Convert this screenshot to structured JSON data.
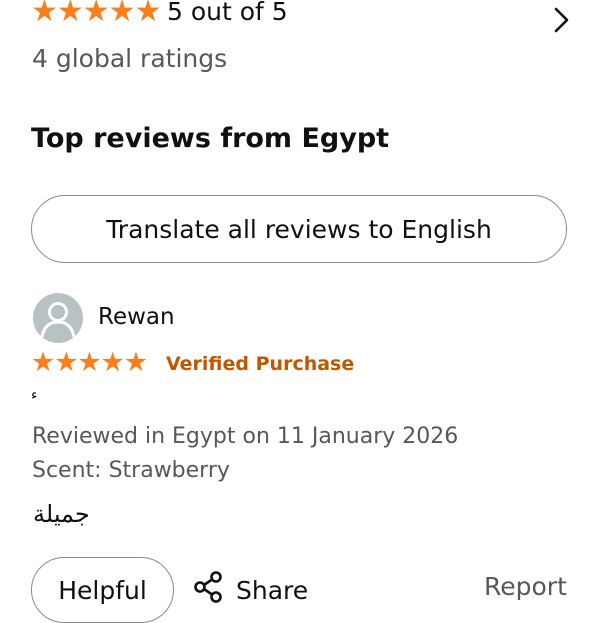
{
  "summary": {
    "stars": "★★★★★",
    "rating_text": "5 out of 5",
    "global_ratings": "4 global ratings"
  },
  "section": {
    "heading": "Top reviews from Egypt",
    "translate_label": "Translate all reviews to English"
  },
  "review": {
    "reviewer": "Rewan",
    "stars": "★★★★★",
    "verified": "Verified Purchase",
    "mark": "ء",
    "reviewed_in": "Reviewed in Egypt on 11 January 2026",
    "scent": "Scent: Strawberry",
    "body": "جميلة",
    "helpful_label": "Helpful",
    "share_label": "Share",
    "report_label": "Report"
  },
  "colors": {
    "star": "#fa7e1c",
    "verified": "#c45500",
    "secondary_text": "#565959",
    "border": "#888c8c"
  },
  "icons": [
    "chevron-right-icon",
    "avatar-icon",
    "share-icon"
  ]
}
